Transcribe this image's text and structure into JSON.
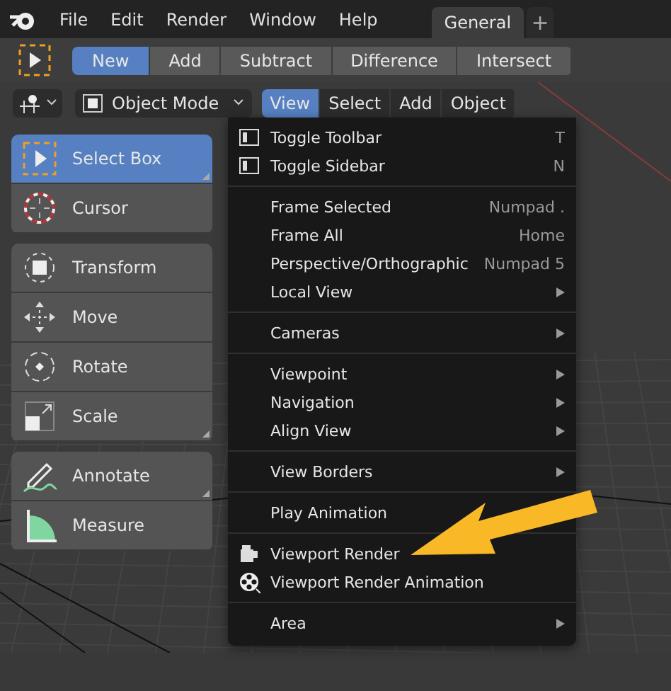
{
  "top_menu": [
    "File",
    "Edit",
    "Render",
    "Window",
    "Help"
  ],
  "workspace_tabs": [
    {
      "label": "General",
      "selected": true
    }
  ],
  "add_tab": "+",
  "mode_buttons": [
    {
      "label": "New",
      "selected": true
    },
    {
      "label": "Add",
      "selected": false
    },
    {
      "label": "Subtract",
      "selected": false
    },
    {
      "label": "Difference",
      "selected": false
    },
    {
      "label": "Intersect",
      "selected": false
    }
  ],
  "interaction_mode": "Object Mode",
  "viewport_menus": [
    {
      "label": "View",
      "selected": true
    },
    {
      "label": "Select",
      "selected": false
    },
    {
      "label": "Add",
      "selected": false
    },
    {
      "label": "Object",
      "selected": false
    }
  ],
  "toolbar_groups": [
    [
      {
        "label": "Select Box",
        "kind": "select",
        "selected": true,
        "variants": true
      },
      {
        "label": "Cursor",
        "kind": "cursor",
        "selected": false,
        "variants": false
      }
    ],
    [
      {
        "label": "Transform",
        "kind": "transform",
        "selected": false,
        "variants": false
      },
      {
        "label": "Move",
        "kind": "move",
        "selected": false,
        "variants": false
      },
      {
        "label": "Rotate",
        "kind": "rotate",
        "selected": false,
        "variants": false
      },
      {
        "label": "Scale",
        "kind": "scale",
        "selected": false,
        "variants": true
      }
    ],
    [
      {
        "label": "Annotate",
        "kind": "annotate",
        "selected": false,
        "variants": true
      },
      {
        "label": "Measure",
        "kind": "measure",
        "selected": false,
        "variants": false
      }
    ]
  ],
  "view_menu": [
    [
      {
        "label": "Toggle Toolbar",
        "kind": "panel",
        "shortcut": "T"
      },
      {
        "label": "Toggle Sidebar",
        "kind": "panel",
        "shortcut": "N"
      }
    ],
    [
      {
        "label": "Frame Selected",
        "kind": "action",
        "shortcut": "Numpad ."
      },
      {
        "label": "Frame All",
        "kind": "action",
        "shortcut": "Home"
      },
      {
        "label": "Perspective/Orthographic",
        "kind": "action",
        "shortcut": "Numpad 5"
      },
      {
        "label": "Local View",
        "kind": "submenu"
      }
    ],
    [
      {
        "label": "Cameras",
        "kind": "submenu"
      }
    ],
    [
      {
        "label": "Viewpoint",
        "kind": "submenu"
      },
      {
        "label": "Navigation",
        "kind": "submenu"
      },
      {
        "label": "Align View",
        "kind": "submenu"
      }
    ],
    [
      {
        "label": "View Borders",
        "kind": "submenu"
      }
    ],
    [
      {
        "label": "Play Animation",
        "kind": "action"
      }
    ],
    [
      {
        "label": "Viewport Render",
        "kind": "render"
      },
      {
        "label": "Viewport Render Animation",
        "kind": "render-animation"
      }
    ],
    [
      {
        "label": "Area",
        "kind": "submenu"
      }
    ]
  ]
}
